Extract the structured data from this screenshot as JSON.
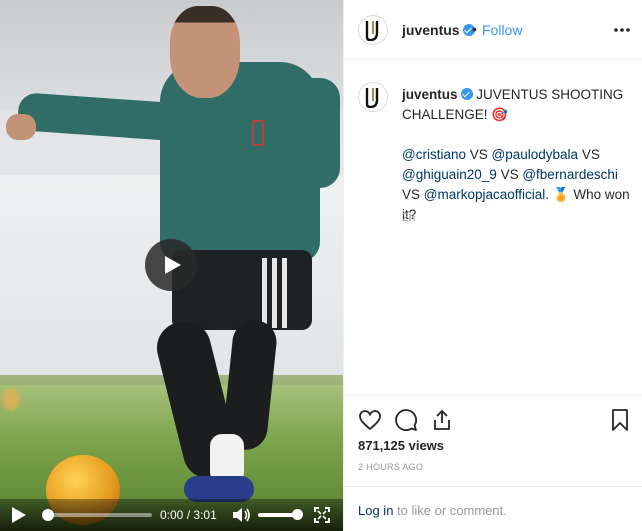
{
  "video": {
    "current_time": "0:00",
    "time_separator": "/",
    "duration": "3:01"
  },
  "header": {
    "username": "juventus",
    "dot": "•",
    "follow_label": "Follow"
  },
  "caption": {
    "username": "juventus",
    "text_line1": "JUVENTUS SHOOTING CHALLENGE!",
    "emoji_target": "🎯",
    "mentions": [
      "@cristiano",
      "@paulodybala",
      "@ghiguain20_9",
      "@fbernardeschi",
      "@markopjacaofficial."
    ],
    "vs": "VS",
    "emoji_medal": "🏅",
    "question": "Who won it?",
    "time_ago": "2h"
  },
  "stats": {
    "views": "871,125 views",
    "posted": "2 HOURS AGO"
  },
  "comment": {
    "login_link": "Log in",
    "login_suffix": " to like or comment."
  },
  "colors": {
    "accent": "#3897f0",
    "mention": "#003569",
    "jersey": "#2f6d66"
  },
  "icons": [
    "play-icon",
    "verified-icon",
    "more-options-icon",
    "heart-icon",
    "comment-icon",
    "share-icon",
    "bookmark-icon",
    "volume-icon",
    "fullscreen-icon",
    "juventus-logo"
  ]
}
